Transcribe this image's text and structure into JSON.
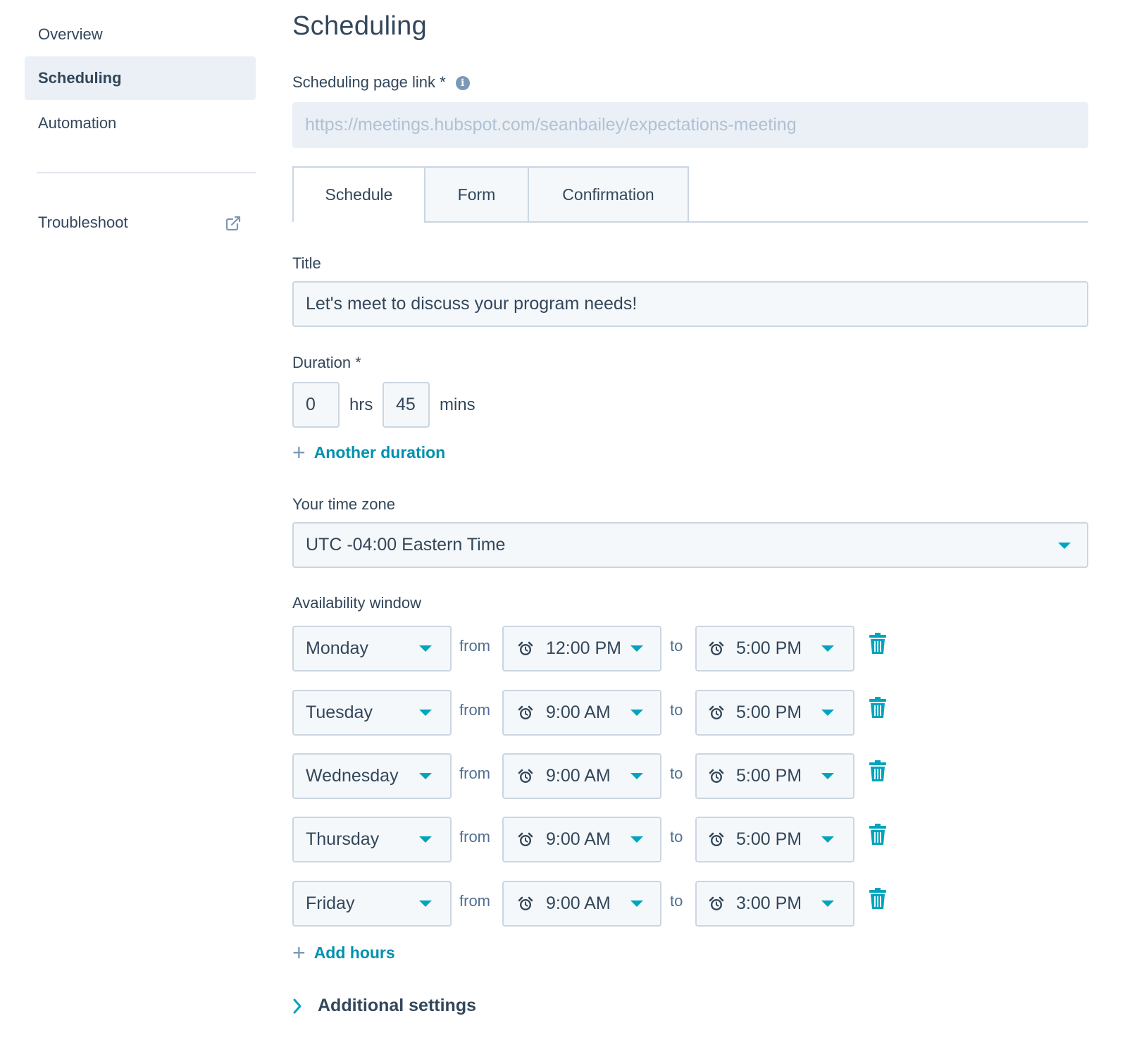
{
  "sidebar": {
    "items": [
      {
        "label": "Overview",
        "active": false
      },
      {
        "label": "Scheduling",
        "active": true
      },
      {
        "label": "Automation",
        "active": false
      }
    ],
    "troubleshoot": {
      "label": "Troubleshoot",
      "icon": "external-link-icon"
    }
  },
  "page": {
    "title": "Scheduling"
  },
  "link": {
    "label": "Scheduling page link *",
    "info_icon": "i",
    "value": "https://meetings.hubspot.com/seanbailey/expectations-meeting"
  },
  "tabs": [
    {
      "label": "Schedule",
      "active": true
    },
    {
      "label": "Form",
      "active": false
    },
    {
      "label": "Confirmation",
      "active": false
    }
  ],
  "title_field": {
    "label": "Title",
    "value": "Let's meet to discuss your program needs!"
  },
  "duration": {
    "label": "Duration *",
    "hours": "0",
    "hours_unit": "hrs",
    "minutes": "45",
    "minutes_unit": "mins",
    "add_label": "Another duration"
  },
  "timezone": {
    "label": "Your time zone",
    "value": "UTC -04:00 Eastern Time"
  },
  "availability": {
    "label": "Availability window",
    "from_word": "from",
    "to_word": "to",
    "rows": [
      {
        "day": "Monday",
        "from": "12:00 PM",
        "to": "5:00 PM"
      },
      {
        "day": "Tuesday",
        "from": "9:00 AM",
        "to": "5:00 PM"
      },
      {
        "day": "Wednesday",
        "from": "9:00 AM",
        "to": "5:00 PM"
      },
      {
        "day": "Thursday",
        "from": "9:00 AM",
        "to": "5:00 PM"
      },
      {
        "day": "Friday",
        "from": "9:00 AM",
        "to": "3:00 PM"
      }
    ],
    "add_label": "Add hours"
  },
  "additional_settings": {
    "label": "Additional settings"
  },
  "colors": {
    "accent": "#00a4bd",
    "link": "#0091ae",
    "text": "#33475b",
    "field_bg": "#f5f8fa",
    "border": "#cbd6e2"
  }
}
